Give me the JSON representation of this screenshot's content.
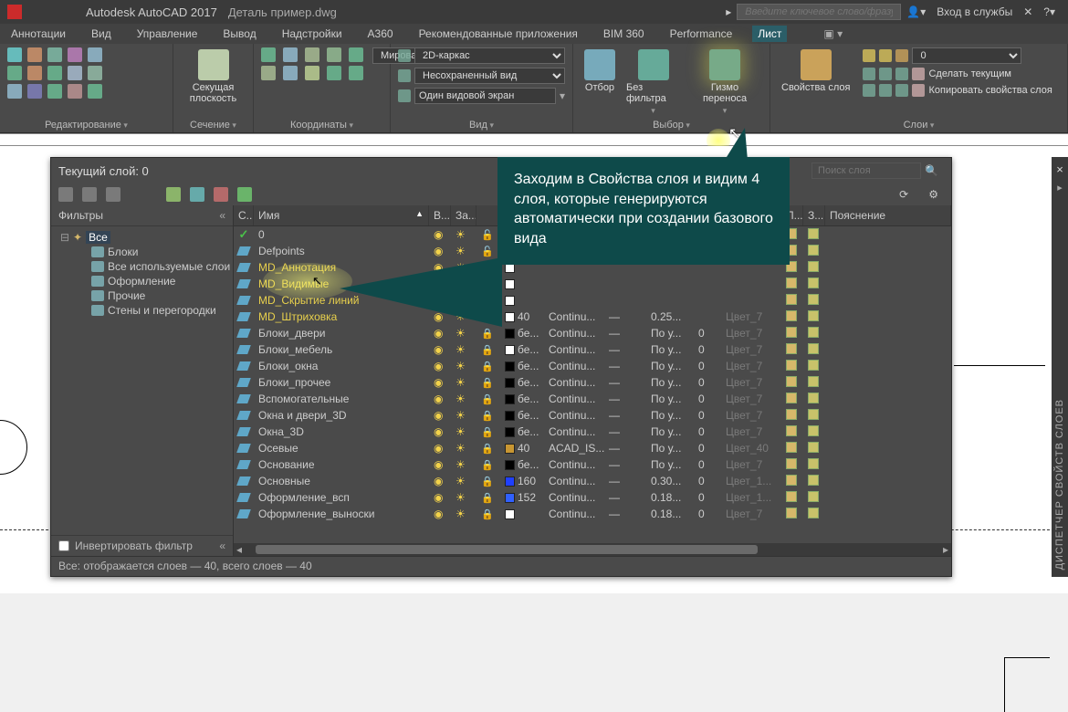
{
  "title": {
    "app": "Autodesk AutoCAD 2017",
    "file": "Деталь пример.dwg",
    "search_ph": "Введите ключевое слово/фразу",
    "signin": "Вход в службы"
  },
  "menu": {
    "items": [
      "Аннотации",
      "Вид",
      "Управление",
      "Вывод",
      "Надстройки",
      "A360",
      "Рекомендованные приложения",
      "BIM 360",
      "Performance",
      "Лист"
    ],
    "active": 9
  },
  "ribbon": {
    "panels": [
      {
        "caption": "Редактирование"
      },
      {
        "caption": "Сечение"
      },
      {
        "caption": "Координаты"
      },
      {
        "caption": "Вид",
        "combo1": "2D-каркас",
        "combo2": "Несохраненный вид",
        "combo3": "Мировая",
        "btn": "Один видовой экран"
      },
      {
        "caption": "Выбор",
        "b1": "Отбор",
        "b2": "Без фильтра",
        "b3": "Гизмо переноса"
      },
      {
        "caption": "Слои",
        "big": "Свойства слоя",
        "opt1": "Сделать текущим",
        "opt2": "Копировать свойства слоя"
      }
    ],
    "sekush": "Секущая плоскость"
  },
  "lpm": {
    "current_layer": "Текущий слой: 0",
    "search_ph": "Поиск слоя",
    "filters_label": "Фильтры",
    "invert_label": "Инвертировать фильтр",
    "status_line": "Все: отображается слоев — 40, всего слоев — 40",
    "filters": {
      "root": "Все",
      "children": [
        "Блоки",
        "Все используемые слои",
        "Оформление",
        "Прочие",
        "Стены и перегородки"
      ]
    },
    "columns": {
      "status": "С...",
      "name": "Имя",
      "on": "В...",
      "freeze": "За...",
      "lock": "",
      "color": "",
      "ltype": "",
      "lw": "",
      "trans": "",
      "plot": "",
      "pstyle": "",
      "plot2": "П...",
      "new": "З...",
      "desc": "Пояснение"
    },
    "layers": [
      {
        "name": "0",
        "current": true,
        "on": true,
        "lock": false,
        "color": "#ffffff",
        "cnum": "",
        "ltype": "",
        "lw": "",
        "trans": "",
        "pstyle": ""
      },
      {
        "name": "Defpoints",
        "on": true,
        "lock": false,
        "color": "#ffffff"
      },
      {
        "name": "MD_Аннотация",
        "md": true,
        "on": true,
        "lock": false,
        "color": "#ffffff"
      },
      {
        "name": "MD_Видимые",
        "md": true,
        "on": true,
        "lock": false,
        "color": "#ffffff"
      },
      {
        "name": "MD_Скрытие линий",
        "md": true,
        "on": true,
        "lock": false,
        "color": "#ffffff"
      },
      {
        "name": "MD_Штриховка",
        "md": true,
        "on": true,
        "lock": false,
        "color": "#ffffff",
        "cnum": "40",
        "ltype": "Continu...",
        "lw": "—",
        "trans": "0.25...",
        "pstyle": "Цвет_7"
      },
      {
        "name": "Блоки_двери",
        "on": true,
        "lock": true,
        "color": "#000000",
        "cnum": "бе...",
        "ltype": "Continu...",
        "lw": "—",
        "trans": "По у...",
        "tval": "0",
        "pstyle": "Цвет_7"
      },
      {
        "name": "Блоки_мебель",
        "on": true,
        "lock": true,
        "color": "#ffffff",
        "cnum": "бе...",
        "ltype": "Continu...",
        "lw": "—",
        "trans": "По у...",
        "tval": "0",
        "pstyle": "Цвет_7"
      },
      {
        "name": "Блоки_окна",
        "on": true,
        "lock": true,
        "color": "#000000",
        "cnum": "бе...",
        "ltype": "Continu...",
        "lw": "—",
        "trans": "По у...",
        "tval": "0",
        "pstyle": "Цвет_7"
      },
      {
        "name": "Блоки_прочее",
        "on": true,
        "lock": true,
        "color": "#000000",
        "cnum": "бе...",
        "ltype": "Continu...",
        "lw": "—",
        "trans": "По у...",
        "tval": "0",
        "pstyle": "Цвет_7"
      },
      {
        "name": "Вспомогательные",
        "on": true,
        "lock": true,
        "color": "#000000",
        "cnum": "бе...",
        "ltype": "Continu...",
        "lw": "—",
        "trans": "По у...",
        "tval": "0",
        "pstyle": "Цвет_7"
      },
      {
        "name": "Окна и двери_3D",
        "on": true,
        "lock": true,
        "color": "#000000",
        "cnum": "бе...",
        "ltype": "Continu...",
        "lw": "—",
        "trans": "По у...",
        "tval": "0",
        "pstyle": "Цвет_7"
      },
      {
        "name": "Окна_3D",
        "on": true,
        "lock": true,
        "color": "#000000",
        "cnum": "бе...",
        "ltype": "Continu...",
        "lw": "—",
        "trans": "По у...",
        "tval": "0",
        "pstyle": "Цвет_7"
      },
      {
        "name": "Осевые",
        "on": true,
        "lock": true,
        "color": "#c89632",
        "cnum": "40",
        "ltype": "ACAD_IS...",
        "lw": "—",
        "trans": "По у...",
        "tval": "0",
        "pstyle": "Цвет_40"
      },
      {
        "name": "Основание",
        "on": true,
        "lock": true,
        "color": "#000000",
        "cnum": "бе...",
        "ltype": "Continu...",
        "lw": "—",
        "trans": "По у...",
        "tval": "0",
        "pstyle": "Цвет_7"
      },
      {
        "name": "Основные",
        "on": true,
        "lock": true,
        "color": "#2040ff",
        "cnum": "160",
        "ltype": "Continu...",
        "lw": "—",
        "trans": "0.30...",
        "tval": "0",
        "pstyle": "Цвет_1..."
      },
      {
        "name": "Оформление_всп",
        "on": true,
        "lock": true,
        "color": "#3060ff",
        "cnum": "152",
        "ltype": "Continu...",
        "lw": "—",
        "trans": "0.18...",
        "tval": "0",
        "pstyle": "Цвет_1..."
      },
      {
        "name": "Оформление_выноски",
        "on": true,
        "lock": true,
        "color": "#ffffff",
        "cnum": "",
        "ltype": "Continu...",
        "lw": "—",
        "trans": "0.18...",
        "tval": "0",
        "pstyle": "Цвет_7"
      }
    ]
  },
  "callout_text": "Заходим в Свойства слоя и видим 4 слоя, которые генерируются автоматически при создании базового вида",
  "sidetab": "ДИСПЕТЧЕР СВОЙСТВ СЛОЕВ",
  "layer_combo_value": "0"
}
